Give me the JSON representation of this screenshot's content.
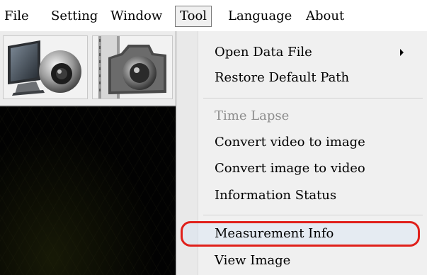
{
  "menubar": {
    "items": [
      "File",
      "Setting",
      "Window",
      "Tool",
      "Language",
      "About"
    ],
    "active": "Tool"
  },
  "toolbar": {
    "buttons": [
      {
        "icon": "monitor-webcam-icon"
      },
      {
        "icon": "camera-film-icon"
      }
    ]
  },
  "tool_menu": {
    "items": [
      {
        "label": "Open Data File",
        "has_submenu": true,
        "enabled": true
      },
      {
        "label": "Restore Default Path",
        "enabled": true
      },
      {
        "label": "Time Lapse",
        "enabled": false
      },
      {
        "label": "Convert video to image",
        "enabled": true
      },
      {
        "label": "Convert image to video",
        "enabled": true
      },
      {
        "label": "Information Status",
        "enabled": true
      },
      {
        "label": "Measurement Info",
        "enabled": true,
        "highlighted": true
      },
      {
        "label": "View Image",
        "enabled": true
      }
    ]
  },
  "colors": {
    "highlight_outline": "#e0201b",
    "preview_bg": "#020202",
    "disabled_text": "#8d8d8d"
  }
}
